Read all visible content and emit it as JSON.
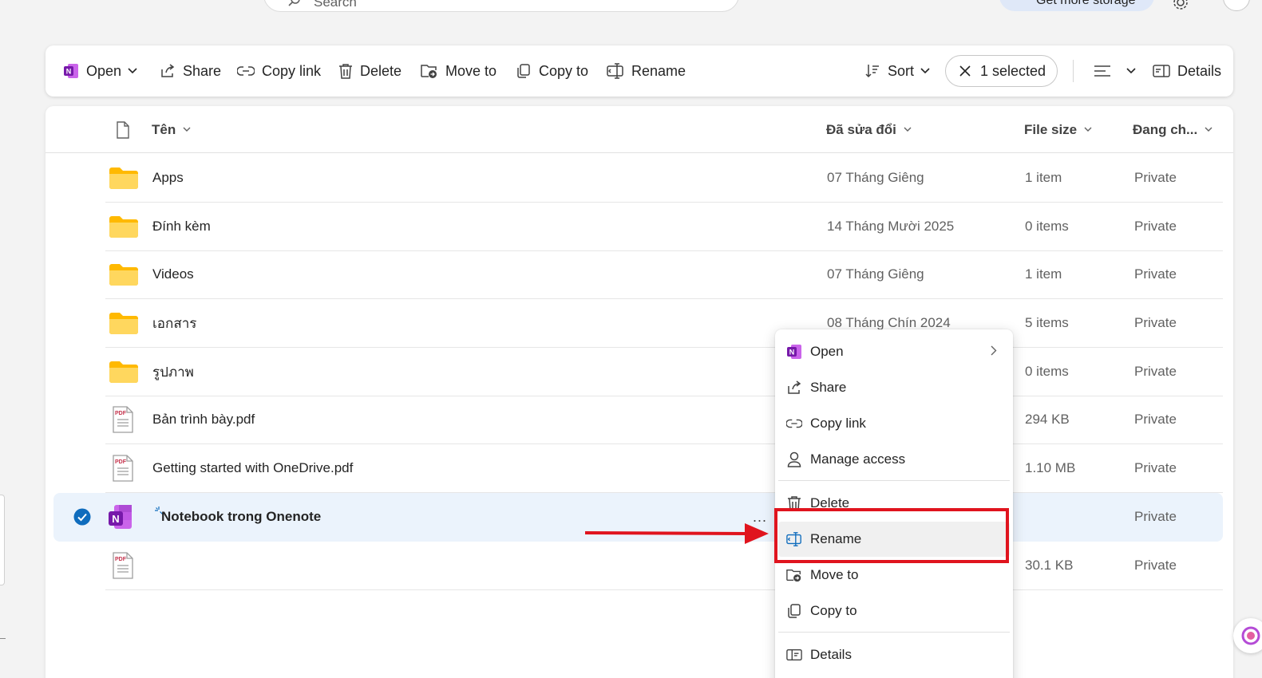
{
  "search": {
    "placeholder": "Search"
  },
  "storage": {
    "label": "Get more storage"
  },
  "toolbar": {
    "open": "Open",
    "share": "Share",
    "copy_link": "Copy link",
    "delete": "Delete",
    "move_to": "Move to",
    "copy_to": "Copy to",
    "rename": "Rename",
    "sort": "Sort",
    "selected": "1 selected",
    "details": "Details"
  },
  "columns": {
    "name": "Tên",
    "modified": "Đã sửa đổi",
    "size": "File size",
    "sharing": "Đang ch..."
  },
  "rows": [
    {
      "type": "folder",
      "name": "Apps",
      "modified": "07 Tháng Giêng",
      "size": "1 item",
      "sharing": "Private"
    },
    {
      "type": "folder",
      "name": "Đính kèm",
      "modified": "14 Tháng Mười 2025",
      "size": "0 items",
      "sharing": "Private"
    },
    {
      "type": "folder",
      "name": "Videos",
      "modified": "07 Tháng Giêng",
      "size": "1 item",
      "sharing": "Private"
    },
    {
      "type": "folder",
      "name": "เอกสาร",
      "modified": "08 Tháng Chín 2024",
      "size": "5 items",
      "sharing": "Private"
    },
    {
      "type": "folder",
      "name": "รูปภาพ",
      "modified": "",
      "size": "0 items",
      "sharing": "Private"
    },
    {
      "type": "pdf",
      "name": "Bản trình bày.pdf",
      "modified": "",
      "size": "294 KB",
      "sharing": "Private"
    },
    {
      "type": "pdf",
      "name": "Getting started with OneDrive.pdf",
      "modified": "",
      "size": "1.10 MB",
      "sharing": "Private"
    },
    {
      "type": "onenote",
      "name": "Notebook trong Onenote",
      "modified": "",
      "size": "",
      "sharing": "Private",
      "selected": true
    },
    {
      "type": "pdf",
      "name": "",
      "modified": "",
      "size": "30.1 KB",
      "sharing": "Private"
    }
  ],
  "more_actions": "...",
  "menu": {
    "open": "Open",
    "share": "Share",
    "copy_link": "Copy link",
    "manage_access": "Manage access",
    "delete": "Delete",
    "rename": "Rename",
    "move_to": "Move to",
    "copy_to": "Copy to",
    "details": "Details"
  },
  "colors": {
    "accent": "#0f6cbd",
    "folder": "#ffc83d",
    "onenote": "#7719aa",
    "highlight": "#e0141e",
    "selected_row": "#ebf3fc"
  }
}
